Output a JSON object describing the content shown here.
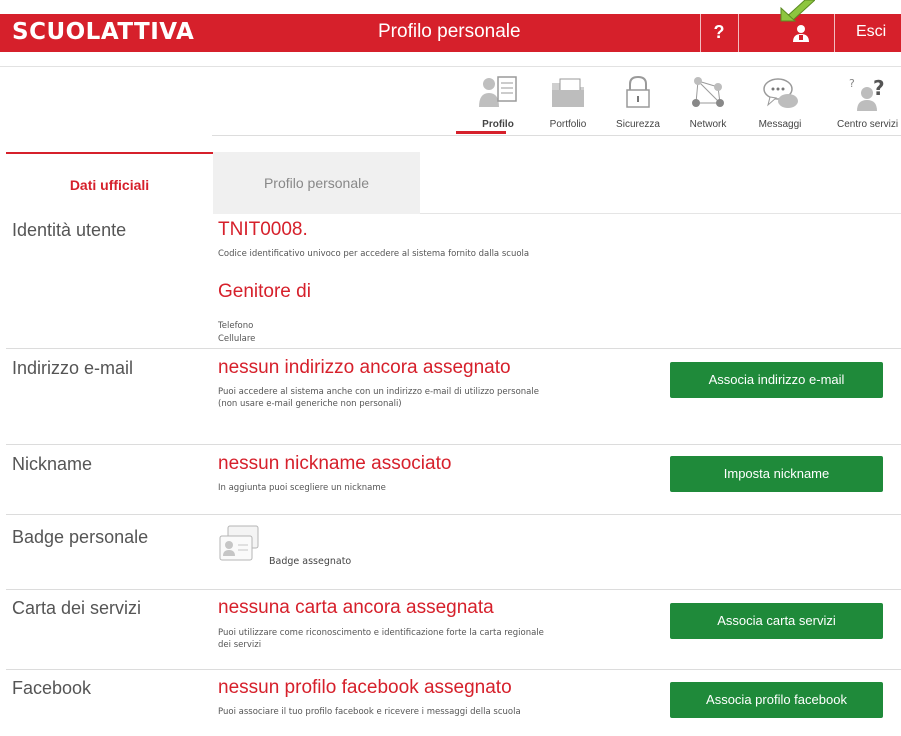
{
  "header": {
    "logo": "SCUOLATTIVA",
    "title": "Profilo personale",
    "help_label": "?",
    "exit_label": "Esci",
    "user_icon": "user-icon",
    "brand_color": "#d6202b"
  },
  "icon_nav": {
    "items": [
      {
        "label": "Profilo",
        "icon": "profile-icon"
      },
      {
        "label": "Portfolio",
        "icon": "folder-icon"
      },
      {
        "label": "Sicurezza",
        "icon": "lock-icon"
      },
      {
        "label": "Network",
        "icon": "network-icon"
      },
      {
        "label": "Messaggi",
        "icon": "chat-icon"
      },
      {
        "label": "Centro servizi",
        "icon": "help-center-icon"
      }
    ],
    "active": "Profilo"
  },
  "tabs": [
    {
      "label": "Dati ufficiali",
      "active": true
    },
    {
      "label": "Profilo personale",
      "active": false
    }
  ],
  "rows": {
    "identity": {
      "label": "Identità utente",
      "value": "TNIT0008.",
      "desc": "Codice identificativo univoco per accedere al sistema fornito dalla scuola",
      "parent_title": "Genitore di",
      "phone_label": "Telefono",
      "mobile_label": "Cellulare"
    },
    "email": {
      "label": "Indirizzo e-mail",
      "value": "nessun indirizzo ancora assegnato",
      "desc_line1": "Puoi accedere al sistema anche con un indirizzo e-mail di utilizzo personale",
      "desc_line2": "(non usare e-mail generiche non personali)",
      "button": "Associa indirizzo e-mail"
    },
    "nickname": {
      "label": "Nickname",
      "value": "nessun nickname associato",
      "desc": "In aggiunta puoi scegliere un nickname",
      "button": "Imposta nickname"
    },
    "badge": {
      "label": "Badge personale",
      "status": "Badge assegnato",
      "icon": "badge-icon"
    },
    "card": {
      "label": "Carta dei servizi",
      "value": "nessuna carta ancora assegnata",
      "desc_line1": "Puoi utilizzare come riconoscimento e identificazione forte la carta regionale",
      "desc_line2": "dei servizi",
      "button": "Associa carta servizi"
    },
    "facebook": {
      "label": "Facebook",
      "value": "nessun profilo facebook assegnato",
      "desc": "Puoi associare il tuo profilo facebook e ricevere i messaggi della scuola",
      "button": "Associa profilo facebook"
    }
  },
  "colors": {
    "accent_red": "#d6202b",
    "button_green": "#1f8a3a",
    "arrow_green": "#8dc63f"
  }
}
